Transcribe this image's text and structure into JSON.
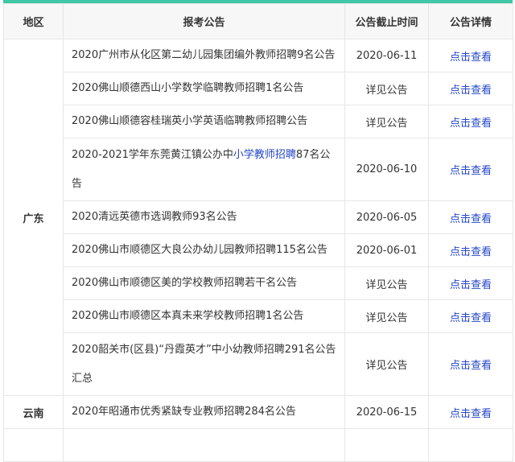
{
  "table": {
    "headers": [
      "地区",
      "报考公告",
      "公告截止时间",
      "公告详情"
    ],
    "groups": [
      {
        "region": "广东",
        "rows": [
          {
            "title": "2020广州市从化区第二幼儿园集团编外教师招聘9名公告",
            "deadline": "2020-06-11",
            "detail": "点击查看"
          },
          {
            "title": "2020佛山顺德西山小学数学临聘教师招聘1名公告",
            "deadline": "详见公告",
            "detail": "点击查看"
          },
          {
            "title": "2020佛山顺德容桂瑞英小学英语临聘教师招聘公告",
            "deadline": "详见公告",
            "detail": "点击查看"
          },
          {
            "title_pre": "2020-2021学年东莞黄江镇公办中",
            "title_kw": "小学教师招聘",
            "title_post": "87名公告",
            "deadline": "2020-06-10",
            "detail": "点击查看"
          },
          {
            "title": "2020清远英德市选调教师93名公告",
            "deadline": "2020-06-05",
            "detail": "点击查看"
          },
          {
            "title": "2020佛山市顺德区大良公办幼儿园教师招聘115名公告",
            "deadline": "2020-06-01",
            "detail": "点击查看"
          },
          {
            "title": "2020佛山市顺德区美的学校教师招聘若干名公告",
            "deadline": "详见公告",
            "detail": "点击查看"
          },
          {
            "title": "2020佛山市顺德区本真未来学校教师招聘1名公告",
            "deadline": "详见公告",
            "detail": "点击查看"
          },
          {
            "title": "2020韶关市(区县)“丹霞英才”中小幼教师招聘291名公告汇总",
            "deadline": "详见公告",
            "detail": "点击查看"
          }
        ]
      },
      {
        "region": "云南",
        "rows": [
          {
            "title": "2020年昭通市优秀紧缺专业教师招聘284名公告",
            "deadline": "2020-06-15",
            "detail": "点击查看"
          }
        ]
      }
    ]
  },
  "colors": {
    "accent": "#3fc8a5",
    "link": "#2346c8",
    "header_bg": "#f7f7f7",
    "border": "#e6e6e6"
  }
}
